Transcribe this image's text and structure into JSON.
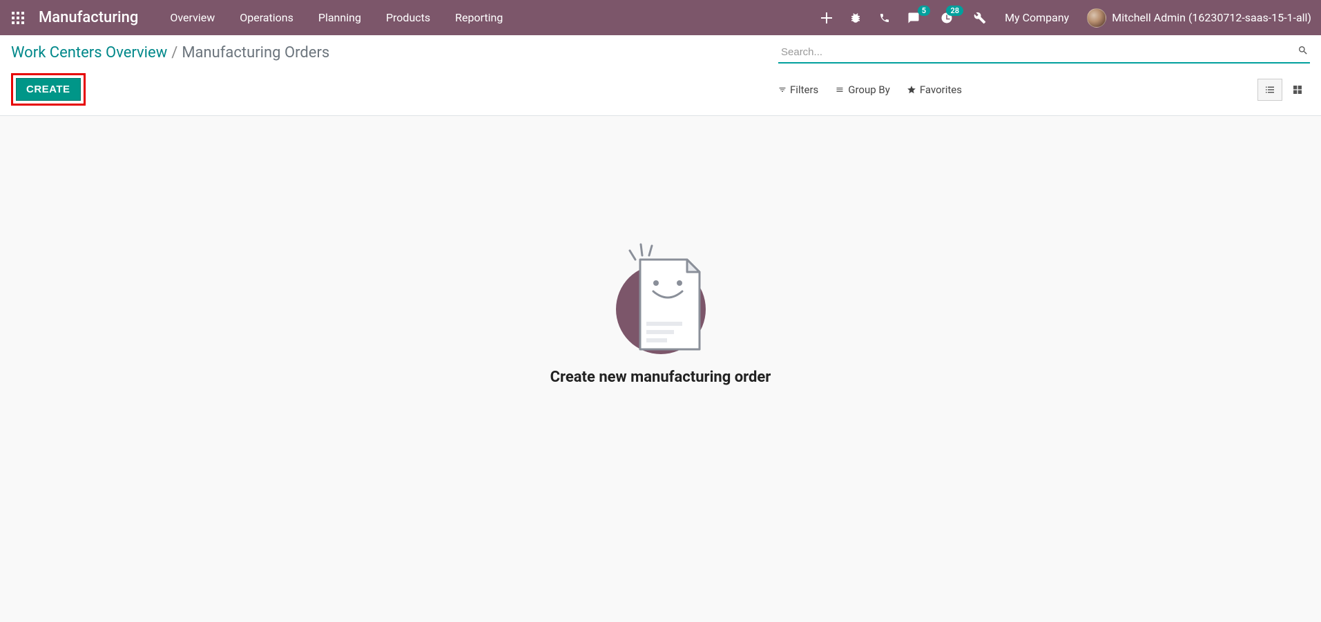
{
  "navbar": {
    "app_title": "Manufacturing",
    "menu": [
      "Overview",
      "Operations",
      "Planning",
      "Products",
      "Reporting"
    ],
    "messaging_badge": "5",
    "activities_badge": "28",
    "company": "My Company",
    "user": "Mitchell Admin (16230712-saas-15-1-all)"
  },
  "breadcrumb": {
    "link": "Work Centers Overview",
    "sep": "/",
    "current": "Manufacturing Orders"
  },
  "buttons": {
    "create": "CREATE"
  },
  "search": {
    "placeholder": "Search...",
    "filters": "Filters",
    "group_by": "Group By",
    "favorites": "Favorites"
  },
  "empty": {
    "title": "Create new manufacturing order"
  }
}
